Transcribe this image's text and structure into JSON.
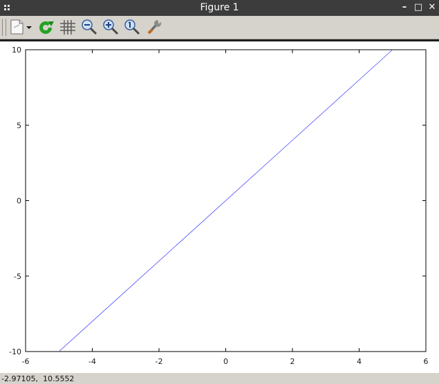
{
  "window": {
    "title": "Figure 1",
    "minimize_label": "–",
    "maximize_label": "□",
    "close_label": "✕"
  },
  "toolbar": {
    "tools": [
      {
        "name": "export-icon"
      },
      {
        "name": "dropdown-arrow-icon"
      },
      {
        "name": "refresh-icon"
      },
      {
        "name": "grid-icon"
      },
      {
        "name": "zoom-out-icon"
      },
      {
        "name": "zoom-in-icon"
      },
      {
        "name": "zoom-reset-icon"
      },
      {
        "name": "settings-wrench-icon"
      }
    ]
  },
  "status": {
    "coords": "-2.97105,  10.5552"
  },
  "colors": {
    "line": "#4a4aff",
    "titlebar": "#3c3c3c",
    "toolbar": "#d6d2cc"
  },
  "chart_data": {
    "type": "line",
    "xlim": [
      -6,
      6
    ],
    "ylim": [
      -10,
      10
    ],
    "x_ticks": [
      -6,
      -4,
      -2,
      0,
      2,
      4,
      6
    ],
    "y_ticks": [
      -10,
      -5,
      0,
      5,
      10
    ],
    "grid": false,
    "series": [
      {
        "x": [
          -5,
          5
        ],
        "y": [
          -10,
          10
        ]
      }
    ]
  }
}
